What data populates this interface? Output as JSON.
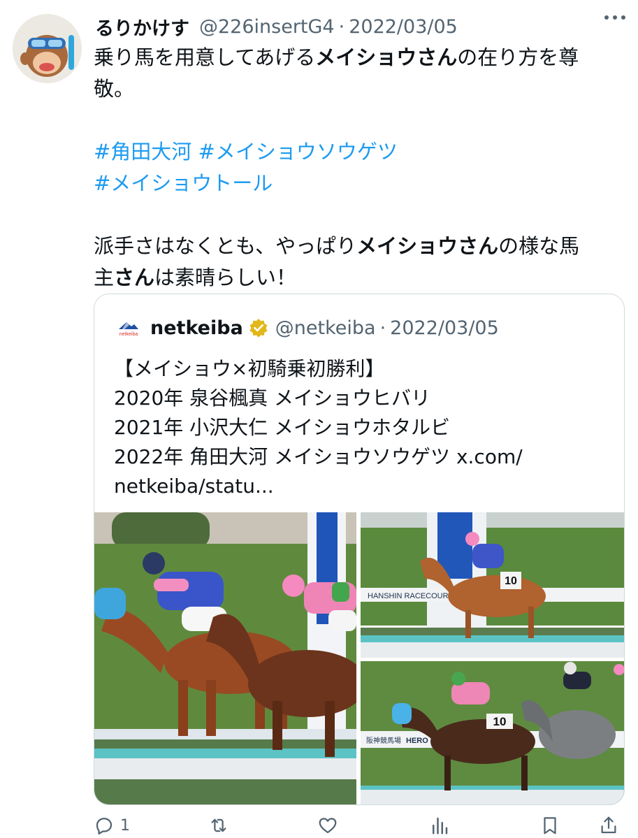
{
  "tweet": {
    "display_name": "るりかけす",
    "handle": "@226insertG4",
    "separator": "·",
    "date": "2022/03/05",
    "line1_a": "乗り馬を用意してあげる",
    "line1_b": "メイショウさん",
    "line1_c": "の在り方を尊",
    "line2": "敬。",
    "hashtag1": "#角田大河",
    "hashtag2": "#メイショウソウゲツ",
    "hashtag3": "#メイショウトール",
    "line3_a": "派手さはなくとも、やっぱり",
    "line3_b": "メイショウさん",
    "line3_c": "の様な馬",
    "line4_a": "主",
    "line4_b": "さん",
    "line4_c": "は素晴らしい！"
  },
  "quote": {
    "display_name": "netkeiba",
    "handle": "@netkeiba",
    "separator": "·",
    "date": "2022/03/05",
    "logo_text": "netkeiba",
    "lines": [
      "【メイショウ×初騎乗初勝利】",
      "2020年 泉谷楓真 メイショウヒバリ",
      "2021年 小沢大仁 メイショウホタルビ",
      "2022年 角田大河 メイショウソウゲツ x.com/",
      "netkeiba/statu..."
    ],
    "photo_signs": {
      "racecourse": "HANSHIN RACECOURSE",
      "saddle_number": "10",
      "hero_sign": "HERO IS",
      "kanji_sign": "阪神競馬場"
    }
  },
  "actions": {
    "reply_icon": "reply-icon",
    "reply_count": "1",
    "retweet_icon": "retweet-icon",
    "like_icon": "heart-icon",
    "views_icon": "bar-chart-icon",
    "bookmark_icon": "bookmark-icon",
    "share_icon": "share-icon"
  },
  "colors": {
    "link": "#1d9bf0",
    "secondary_text": "#536471",
    "verified_gold": "#e2b719",
    "border": "#cfd9de"
  }
}
